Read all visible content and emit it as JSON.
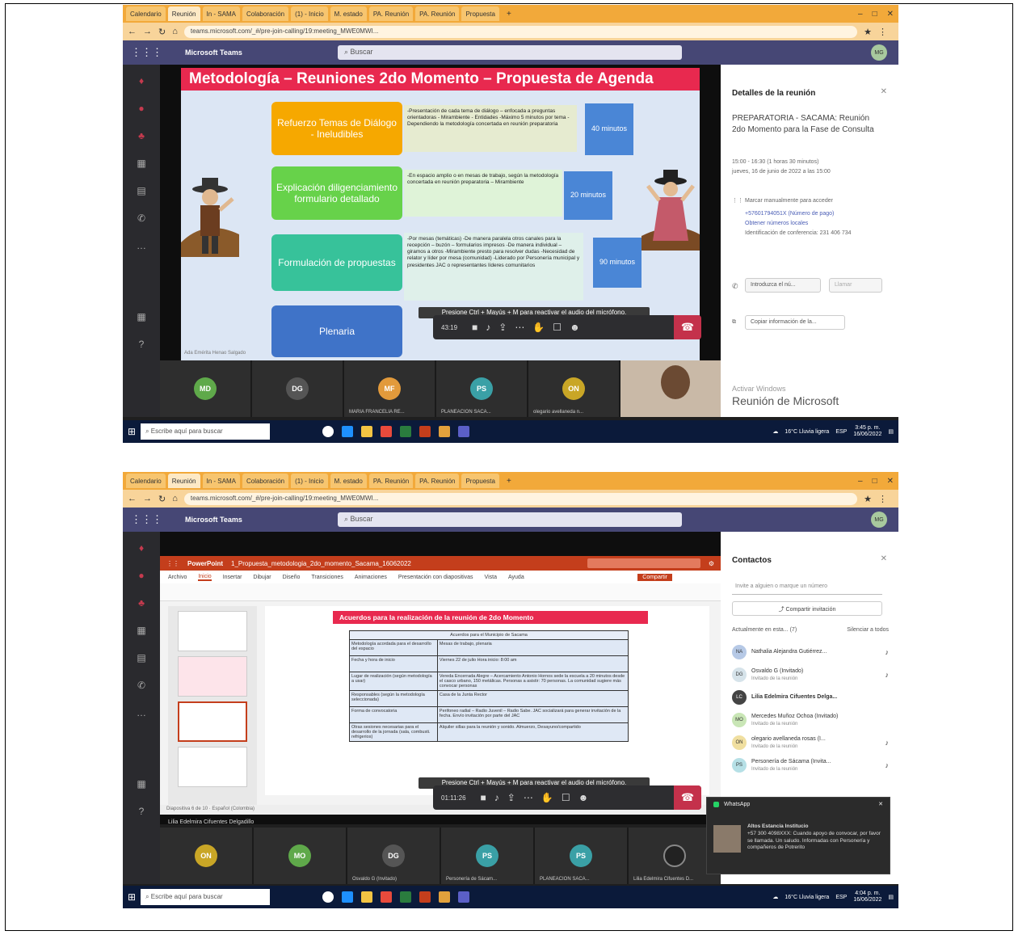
{
  "browser": {
    "tabs": [
      "Calendario",
      "Reunión",
      "In - SAMA",
      "Colaboración",
      "(1) - Inicio",
      "M. estado",
      "PA. Reunión",
      "PA. Reunión",
      "Propuesta"
    ],
    "url": "teams.microsoft.com/_#/pre-join-calling/19:meeting_MWE0MWI..."
  },
  "teams": {
    "app_name": "Microsoft Teams",
    "search_placeholder": "Buscar",
    "profile_initials": "MG"
  },
  "shot1": {
    "slide": {
      "title": "Metodología – Reuniones 2do Momento – Propuesta de Agenda",
      "rows": [
        {
          "label": "Refuerzo Temas de Diálogo - Ineludibles",
          "note": "-Presentación de cada tema de diálogo – enfocada a preguntas orientadoras - Mirambiente - Entidades -Máximo 5 minutos por tema -Dependiendo la metodología concertada en reunión preparatoria",
          "time": "40 minutos"
        },
        {
          "label": "Explicación diligenciamiento formulario detallado",
          "note": "-En espacio amplio o en mesas de trabajo, según la metodología concertada en reunión preparatoria – Mirambiente",
          "time": "20 minutos"
        },
        {
          "label": "Formulación de propuestas",
          "note": "-Por mesas (temáticas) -De manera paralela otros canales para la recepción – buzón – formularios impresos -De manera individual – giramos a otros -Mirambiente presto para resolver dudas -Necesidad de relator y líder por mesa (comunidad) -Liderado por Personería municipal y presidentes JAC o representantes líderes comunitarios",
          "time": "90 minutos"
        },
        {
          "label": "Plenaria",
          "note": "",
          "time": ""
        }
      ],
      "credit": "Ada Emérita Henao Salgado"
    },
    "toast": "Presione Ctrl + Mayús + M para reactivar el audio del micrófono.",
    "call_time": "43:19",
    "panel": {
      "title": "Detalles de la reunión",
      "meeting_name": "PREPARATORIA - SACAMA: Reunión 2do Momento para la Fase de Consulta",
      "time_line": "15:00 - 16:30 (1 horas 30 minutos)",
      "date_line": "jueves, 16 de junio de 2022 a las 15:00",
      "dial_label": "Marcar manualmente para acceder",
      "phone": "+57601794051X (Número de pago)",
      "local_numbers": "Obtener números locales",
      "conf_id": "Identificación de conferencia: 231 406 734",
      "phone_input": "Introduzca el nú...",
      "call_btn": "Llamar",
      "copy_btn": "Copiar información de la...",
      "activate": "Activar Windows",
      "ms_meeting": "Reunión de Microsoft"
    },
    "participants": [
      {
        "initials": "MD",
        "name": "",
        "color": "#5fa94a"
      },
      {
        "initials": "DG",
        "name": "",
        "color": "#3a3a3a"
      },
      {
        "initials": "MF",
        "name": "MARIA FRANCELIA RE...",
        "color": "#e29a3b"
      },
      {
        "initials": "PS",
        "name": "PLANEACION SACA...",
        "color": "#3aa0a6"
      },
      {
        "initials": "ON",
        "name": "olegario avellaneda n...",
        "color": "#c9a626"
      }
    ]
  },
  "shot2": {
    "ppt": {
      "app": "PowerPoint",
      "file": "1_Propuesta_metodologia_2do_momento_Sacama_16062022",
      "menu": [
        "Archivo",
        "Inicio",
        "Insertar",
        "Dibujar",
        "Diseño",
        "Transiciones",
        "Animaciones",
        "Presentación con diapositivas",
        "Vista",
        "Ayuda"
      ],
      "share_btn": "Compartir",
      "slide_title": "Acuerdos para la realización de la reunión de 2do Momento",
      "table_head": "Acuerdos para el Municipio de Sacama",
      "table": [
        [
          "Metodología acordada para el desarrollo del espacio",
          "Mesas de trabajo, plenaria"
        ],
        [
          "Fecha y hora de inicio",
          "Viernes 22 de julio Hora inicio: 8:00 am"
        ],
        [
          "Lugar de realización (según metodología a usar)",
          "Vereda Encerrada Alegre – Acercamiento Antonio Hornos sede la escuela a 20 minutos desde el casco urbano, 150 metálicas. Personas a asistir: 70 personas. La comunidad sugiere más convocar personas"
        ],
        [
          "Responsables (según la metodología seleccionada)",
          "Casa de la Junta Rector"
        ],
        [
          "Forma de convocatoria",
          "Perifoneo radial – Radio Juvenil – Radio Sabe. JAC socializará para generar invitación de la fecha. Envío invitación por parte del JAC"
        ],
        [
          "Otras sesiones necesarias para el desarrollo de la jornada (sala, combusti. refrigerios)",
          "Alquiler sillas para la reunión y sonido. Almuerzo, Desayuno/compartido"
        ]
      ],
      "status": "Diapositiva 6 de 10 · Español (Colombia)"
    },
    "toast": "Presione Ctrl + Mayús + M para reactivar el audio del micrófono.",
    "call_time": "01:11:26",
    "presenter": "Lilia Edelmira Cifuentes Delgadillo",
    "contacts": {
      "title": "Contactos",
      "invite_placeholder": "Invite a alguien o marque un número",
      "share_btn": "Compartir invitación",
      "section": "Actualmente en esta... (7)",
      "mute_all": "Silenciar a todos",
      "list": [
        {
          "initials": "NA",
          "name": "Nathalia Alejandra Gutiérrez...",
          "sub": "",
          "color": "#b6c9e6"
        },
        {
          "initials": "DG",
          "name": "Osvaldo G (Invitado)",
          "sub": "Invitado de la reunión",
          "color": "#d6e3ea"
        },
        {
          "initials": "LC",
          "name": "Lilia Edelmira Cifuentes Delga...",
          "sub": "",
          "color": "#444"
        },
        {
          "initials": "MO",
          "name": "Mercedes Muñoz Ochoa (Invitado)",
          "sub": "Invitado de la reunión",
          "color": "#c9e6b6"
        },
        {
          "initials": "ON",
          "name": "olegario avellaneda rosas (I...",
          "sub": "Invitado de la reunión",
          "color": "#f0dfa0"
        },
        {
          "initials": "PS",
          "name": "Personería de Sácama (Invita...",
          "sub": "Invitado de la reunión",
          "color": "#b6e0e6"
        }
      ]
    },
    "whatsapp": {
      "app": "WhatsApp",
      "sender": "Altos Estancia Institucio",
      "message": "+57 300 4098XXX: Cuando apoyo de convocar, por favor se llamada. Un saludo. Informadas con Personería y compañeros de Potrerito"
    },
    "participants": [
      {
        "initials": "ON",
        "name": "",
        "color": "#c9a626"
      },
      {
        "initials": "MO",
        "name": "",
        "color": "#5fa94a"
      },
      {
        "initials": "DG",
        "name": "Osvaldo G (Invitado)",
        "color": "#3a3a3a"
      },
      {
        "initials": "PS",
        "name": "Personería de Sácam...",
        "color": "#3aa0a6"
      },
      {
        "initials": "PS",
        "name": "PLANEACION SACA...",
        "color": "#3aa0a6"
      },
      {
        "initials": "",
        "name": "Lilia Edelmira Cifuentes D...",
        "color": "#222"
      }
    ]
  },
  "taskbar": {
    "search_placeholder": "Escribe aquí para buscar",
    "weather": "16°C Lluvia ligera",
    "lang": "ESP",
    "time1": "3:45 p. m.",
    "time2": "4:04 p. m.",
    "date": "16/06/2022"
  }
}
